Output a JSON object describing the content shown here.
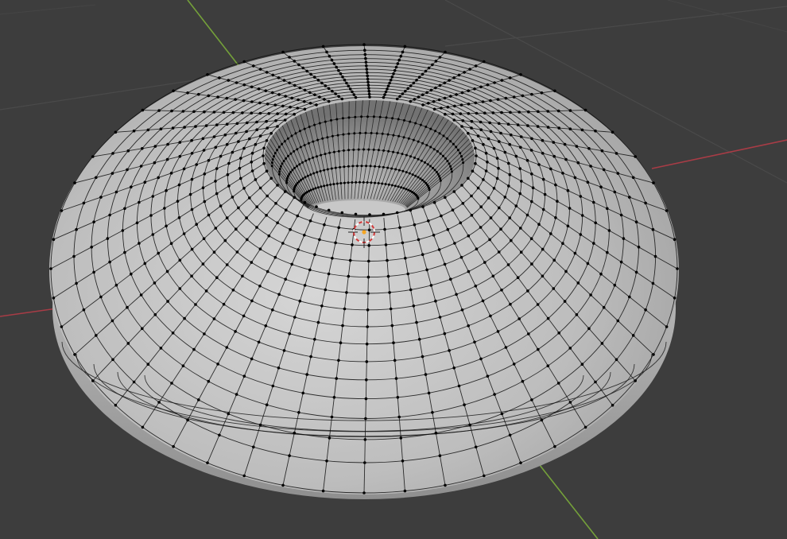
{
  "viewport": {
    "mode": "edit-mode",
    "shading": "solid",
    "background_color": "#3d3d3d",
    "grid_line_color": "#4a4a4a",
    "x_axis_color": "#b0404a",
    "y_axis_color": "#7aa23a"
  },
  "mesh": {
    "object": "torus",
    "surface_color": "#bcbcbc",
    "edge_color": "#111111",
    "vertex_color": "#000000",
    "ring_count": 48,
    "visible_rows": 15
  },
  "cursor_3d": {
    "ring_colors": [
      "#d23a3a",
      "#ffffff"
    ],
    "icon": "3d-cursor-icon"
  },
  "origin": {
    "icon": "object-origin-icon",
    "color": "#f5a623"
  }
}
